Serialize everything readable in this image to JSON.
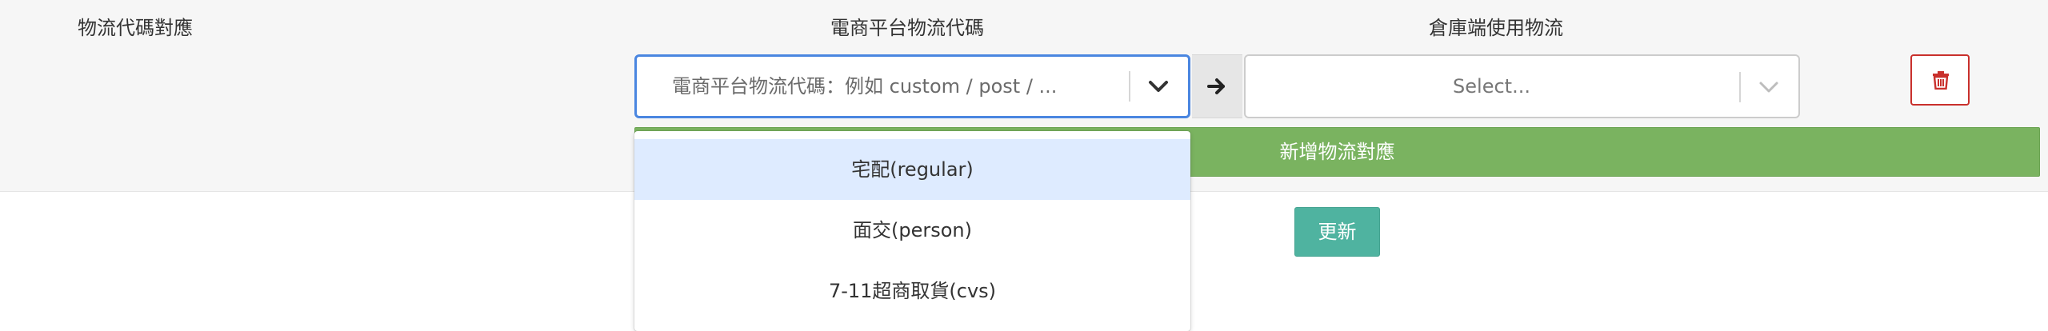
{
  "headers": {
    "mapping": "物流代碼對應",
    "platform": "電商平台物流代碼",
    "warehouse": "倉庫端使用物流"
  },
  "platform_select": {
    "placeholder": "電商平台物流代碼：例如 custom / post / ...",
    "state": "open",
    "options": [
      {
        "label": "宅配(regular)",
        "highlighted": true
      },
      {
        "label": "面交(person)",
        "highlighted": false
      },
      {
        "label": "7-11超商取貨(cvs)",
        "highlighted": false
      }
    ]
  },
  "warehouse_select": {
    "value": "Select..."
  },
  "icons": {
    "platform_dropdown": "chevron-down-icon",
    "arrow": "arrow-right-icon",
    "warehouse_dropdown": "chevron-down-icon",
    "delete": "trash-icon"
  },
  "buttons": {
    "add_mapping": "新增物流對應",
    "update": "更新"
  },
  "colors": {
    "focus_border": "#4a86e0",
    "add_bar": "#7ab360",
    "update_button": "#4fb3a0",
    "delete_border": "#c9302c",
    "menu_highlight": "#deebff"
  }
}
